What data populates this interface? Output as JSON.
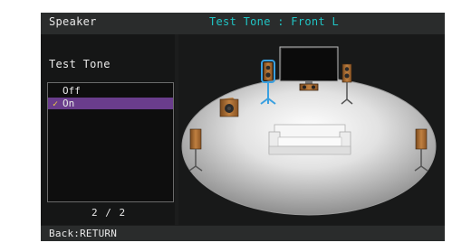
{
  "header": {
    "title": "Speaker",
    "status": "Test Tone : Front L"
  },
  "menu": {
    "label": "Test Tone",
    "options": [
      {
        "label": "Off",
        "checked": false
      },
      {
        "label": "On",
        "checked": true
      }
    ],
    "page": "2 / 2"
  },
  "footer": {
    "back_text": "Back:RETURN"
  },
  "colors": {
    "status": "#20c4c4",
    "selection": "#6a3d8c",
    "highlight": "#3aa0e0"
  },
  "scene": {
    "speakers": [
      "front-left",
      "front-right",
      "center",
      "subwoofer",
      "surround-left",
      "surround-right"
    ],
    "active_speaker": "front-left",
    "icons": [
      "tv-icon",
      "sofa-icon",
      "speaker-icon",
      "checkmark-icon"
    ]
  }
}
